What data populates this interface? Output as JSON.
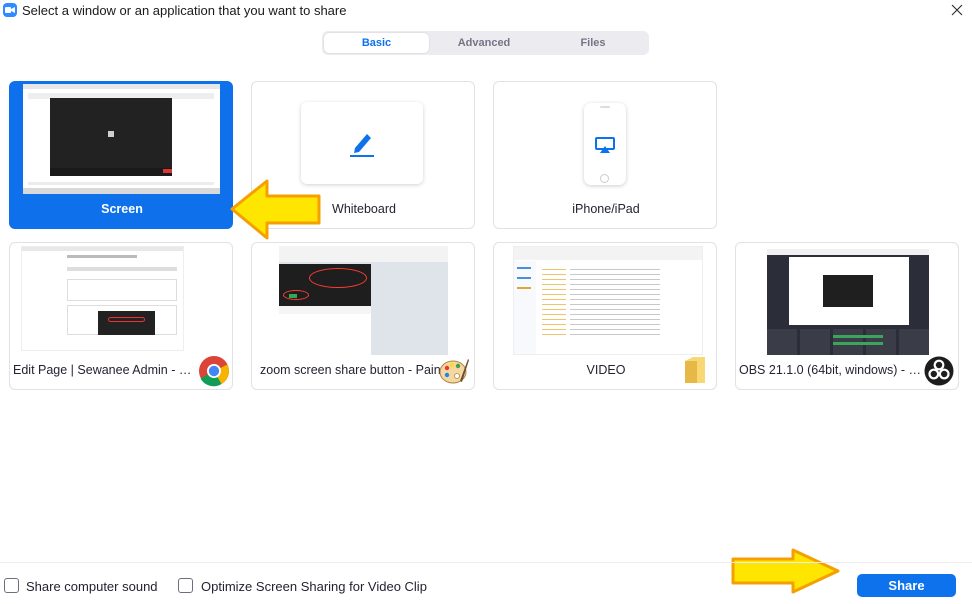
{
  "window": {
    "title": "Select a window or an application that you want to share",
    "app_icon": "zoom-camera-icon",
    "close_icon": "close-icon"
  },
  "tabs": [
    {
      "label": "Basic",
      "active": true
    },
    {
      "label": "Advanced",
      "active": false
    },
    {
      "label": "Files",
      "active": false
    }
  ],
  "tiles": {
    "screen": {
      "label": "Screen",
      "selected": true
    },
    "whiteboard": {
      "label": "Whiteboard",
      "icon": "pen-icon"
    },
    "iphone": {
      "label": "iPhone/iPad",
      "icon": "airplay-icon"
    },
    "chrome": {
      "label": "Edit Page | Sewanee Admin - Goo...",
      "icon": "chrome-icon"
    },
    "paint": {
      "label": "zoom screen share button - Paint",
      "icon": "paint-palette-icon"
    },
    "video": {
      "label": "VIDEO",
      "icon": "folder-icon"
    },
    "obs": {
      "label": "OBS 21.1.0 (64bit, windows) - Pro...",
      "icon": "obs-icon"
    }
  },
  "options": {
    "share_sound": {
      "label": "Share computer sound",
      "checked": false
    },
    "optimize_video": {
      "label": "Optimize Screen Sharing for Video Clip",
      "checked": false
    }
  },
  "share_button": {
    "label": "Share"
  },
  "colors": {
    "accent": "#0e72ed",
    "arrow_fill": "#ffe600",
    "arrow_stroke": "#f5a000"
  }
}
